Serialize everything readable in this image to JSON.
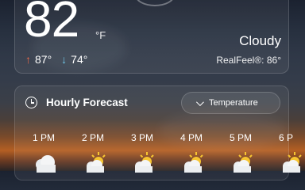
{
  "current": {
    "temperature": "82",
    "unit": "°F",
    "high": "87°",
    "low": "74°",
    "condition": "Cloudy",
    "realfeel": "RealFeel®: 86°"
  },
  "hourly": {
    "title": "Hourly Forecast",
    "metric_button_label": "Temperature",
    "hours": [
      {
        "label": "1 PM",
        "icon": "cloud-icon"
      },
      {
        "label": "2 PM",
        "icon": "partly-sunny-icon"
      },
      {
        "label": "3 PM",
        "icon": "partly-sunny-icon"
      },
      {
        "label": "4 PM",
        "icon": "partly-sunny-icon"
      },
      {
        "label": "5 PM",
        "icon": "partly-sunny-icon"
      },
      {
        "label": "6 P",
        "icon": "partly-sunny-icon"
      }
    ]
  }
}
